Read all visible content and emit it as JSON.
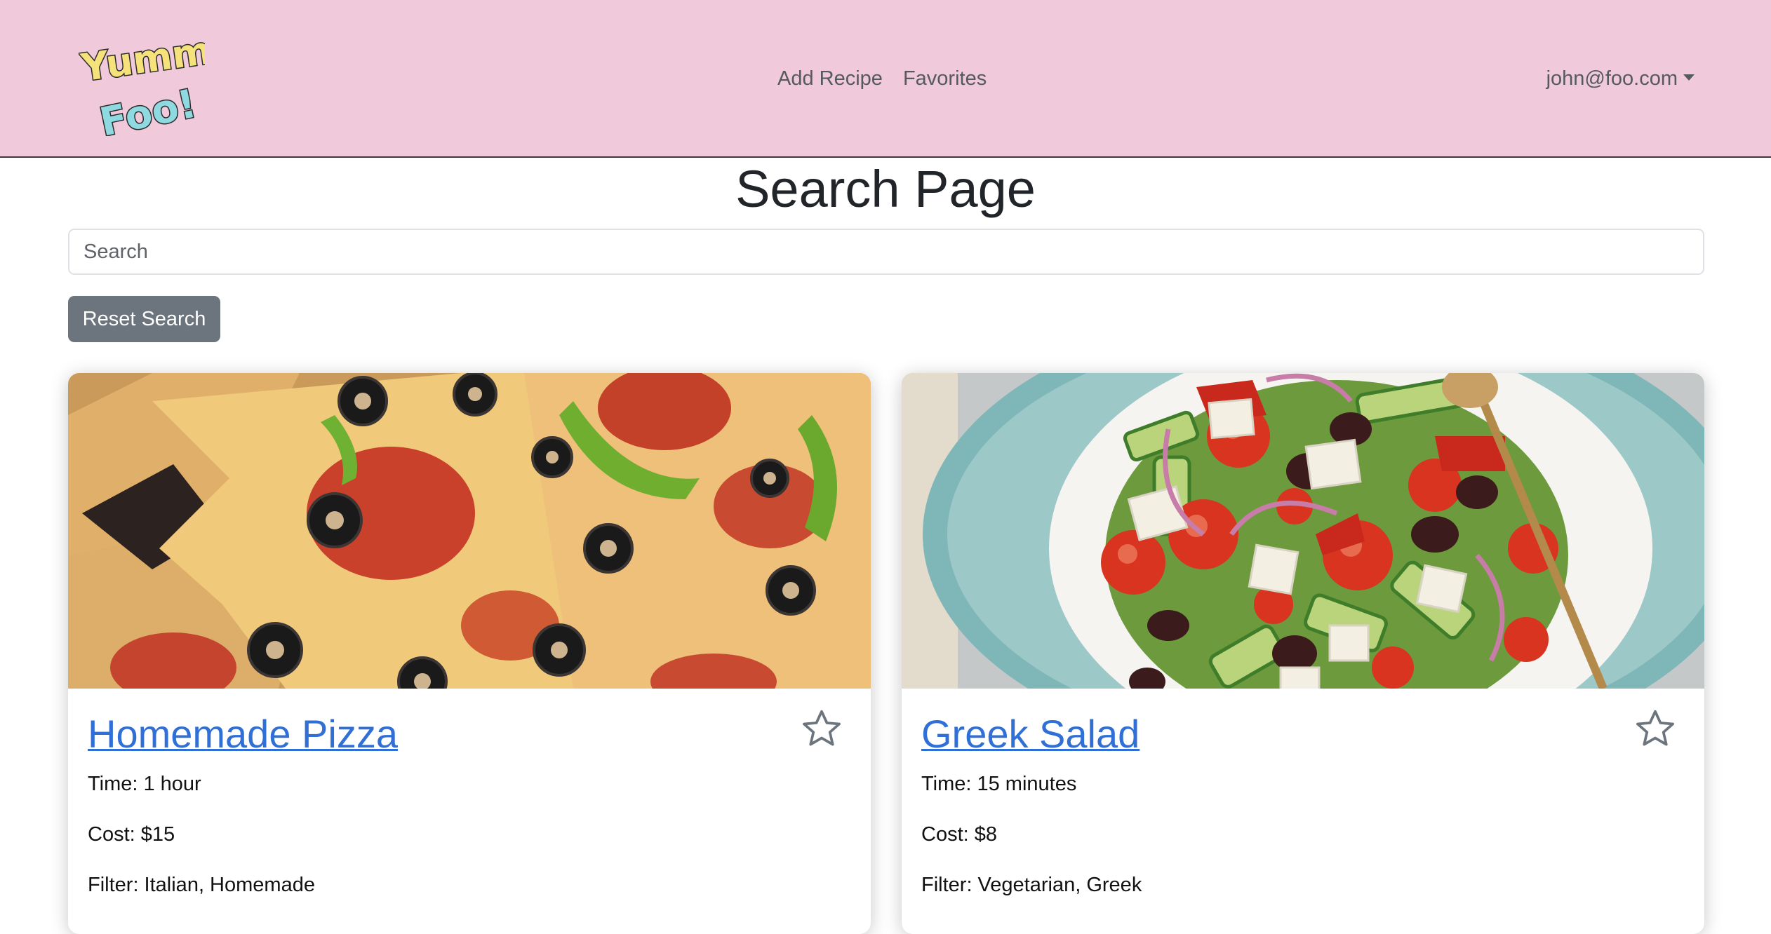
{
  "navbar": {
    "logo_text_top": "Yummy",
    "logo_text_bottom": "Foo!",
    "links": [
      "Add Recipe",
      "Favorites"
    ],
    "user": "john@foo.com",
    "background": "#f0c9da"
  },
  "page": {
    "title": "Search Page",
    "search_placeholder": "Search",
    "search_value": "",
    "reset_label": "Reset Search"
  },
  "recipes": [
    {
      "title": "Homemade Pizza",
      "time": "Time: 1 hour",
      "cost": "Cost: $15",
      "filter": "Filter: Italian, Homemade",
      "favorite": false,
      "image": "pizza-photo"
    },
    {
      "title": "Greek Salad",
      "time": "Time: 15 minutes",
      "cost": "Cost: $8",
      "filter": "Filter: Vegetarian, Greek",
      "favorite": false,
      "image": "greek-salad-photo"
    }
  ],
  "colors": {
    "link": "#2f6fd6",
    "button": "#6c757d",
    "star_outline": "#6c757d"
  }
}
